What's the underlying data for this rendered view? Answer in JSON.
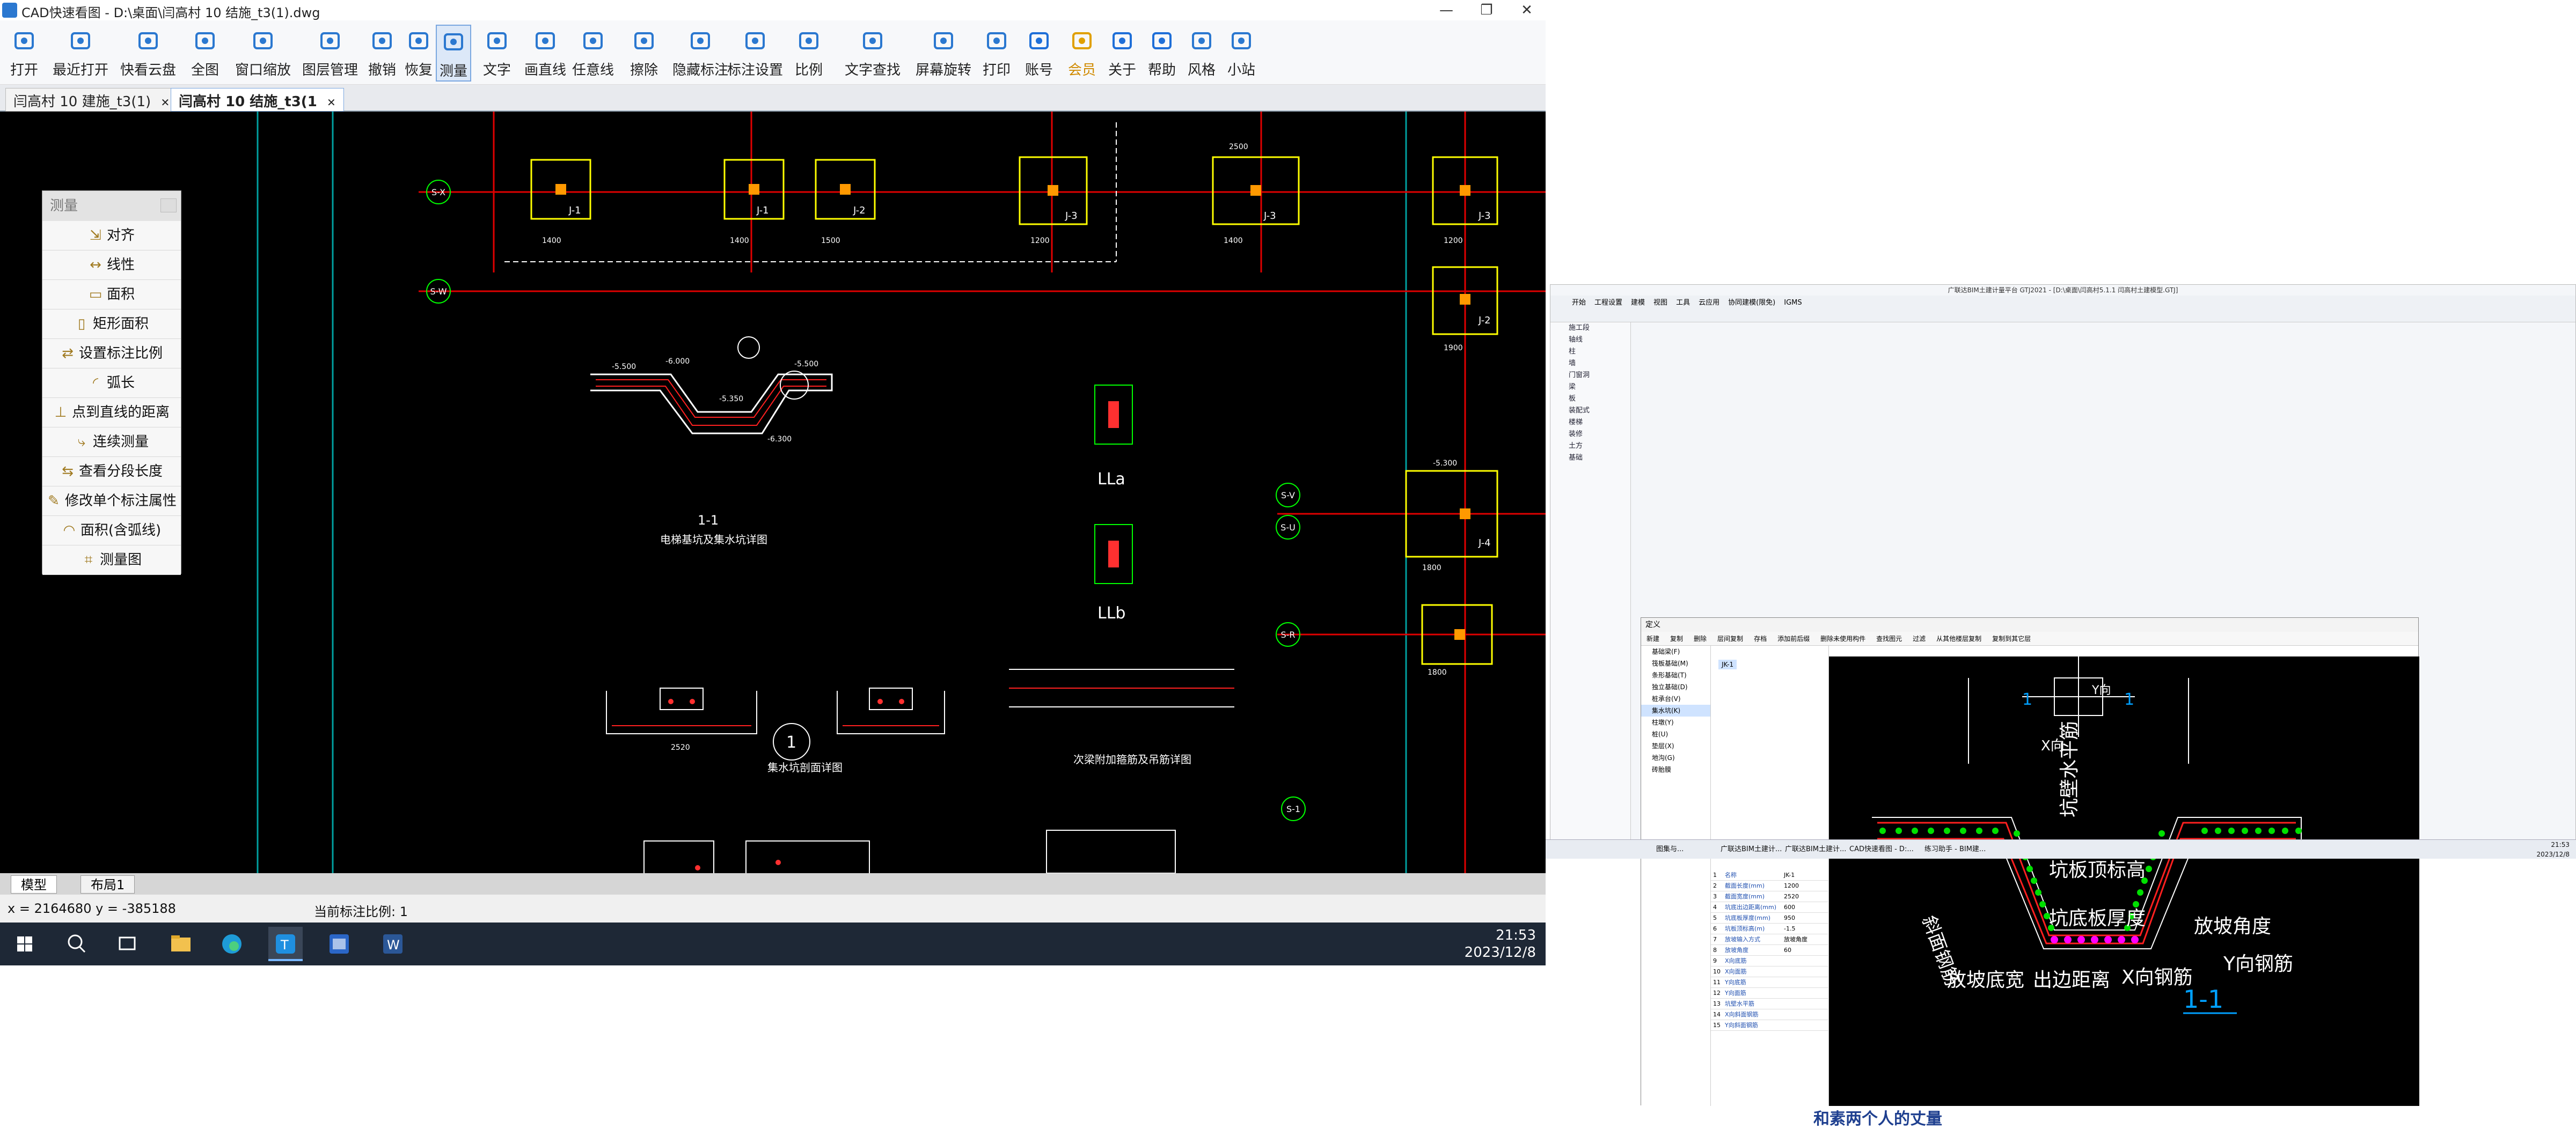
{
  "window": {
    "title": "CAD快速看图 - D:\\桌面\\闫高村 10 结施_t3(1).dwg",
    "controls": [
      "—",
      "❐",
      "✕"
    ]
  },
  "toolbar": [
    {
      "label": "打开",
      "icon": "folder-open-icon"
    },
    {
      "label": "最近打开",
      "icon": "history-icon"
    },
    {
      "label": "快看云盘",
      "icon": "cloud-icon"
    },
    {
      "label": "全图",
      "icon": "fit-all-icon"
    },
    {
      "label": "窗口缩放",
      "icon": "zoom-window-icon"
    },
    {
      "label": "图层管理",
      "icon": "layers-icon"
    },
    {
      "label": "撤销",
      "icon": "undo-icon"
    },
    {
      "label": "恢复",
      "icon": "redo-icon"
    },
    {
      "label": "测量",
      "icon": "measure-icon"
    },
    {
      "label": "文字",
      "icon": "text-icon"
    },
    {
      "label": "画直线",
      "icon": "line-icon"
    },
    {
      "label": "任意线",
      "icon": "freehand-icon"
    },
    {
      "label": "擦除",
      "icon": "eraser-icon"
    },
    {
      "label": "隐藏标注",
      "icon": "hide-annotation-icon"
    },
    {
      "label": "标注设置",
      "icon": "annotation-settings-icon"
    },
    {
      "label": "比例",
      "icon": "scale-icon"
    },
    {
      "label": "文字查找",
      "icon": "text-search-icon"
    },
    {
      "label": "屏幕旋转",
      "icon": "rotate-screen-icon"
    },
    {
      "label": "打印",
      "icon": "print-icon"
    },
    {
      "label": "账号",
      "icon": "account-icon"
    },
    {
      "label": "会员",
      "icon": "vip-icon"
    },
    {
      "label": "关于",
      "icon": "info-icon"
    },
    {
      "label": "帮助",
      "icon": "help-icon"
    },
    {
      "label": "风格",
      "icon": "style-icon"
    },
    {
      "label": "小站",
      "icon": "station-icon"
    }
  ],
  "doc_tabs": [
    {
      "label": "闫高村 10 建施_t3(1)",
      "close": "✕"
    },
    {
      "label": "闫高村 10 结施_t3(1",
      "close": "✕"
    }
  ],
  "measure_panel": {
    "title": "测量",
    "items": [
      {
        "label": "对齐",
        "glyph": "⇲"
      },
      {
        "label": "线性",
        "glyph": "↔"
      },
      {
        "label": "面积",
        "glyph": "▭"
      },
      {
        "label": "矩形面积",
        "glyph": "▯"
      },
      {
        "label": "设置标注比例",
        "glyph": "⇄"
      },
      {
        "label": "弧长",
        "glyph": "◜"
      },
      {
        "label": "点到直线的距离",
        "glyph": "⊥"
      },
      {
        "label": "连续测量",
        "glyph": "⤷"
      },
      {
        "label": "查看分段长度",
        "glyph": "⇆"
      },
      {
        "label": "修改单个标注属性",
        "glyph": "✎"
      },
      {
        "label": "面积(含弧线)",
        "glyph": "◠"
      },
      {
        "label": "测量图",
        "glyph": "⌗"
      }
    ]
  },
  "drawing": {
    "axis_labels": [
      "S-X",
      "S-W",
      "S-V",
      "S-U",
      "S-R",
      "S-1"
    ],
    "footing_labels": [
      "J-1",
      "J-1",
      "J-2",
      "J-3",
      "J-3",
      "J-3",
      "J-3",
      "J-2",
      "J-4",
      "J-4"
    ],
    "section_title": "1-1",
    "section_note": "电梯基坑及集水坑详图",
    "ll_labels": [
      "LLa",
      "LLb"
    ],
    "circle_mark": "1",
    "note_bottom_left": "集水坑剖面详图",
    "note_bottom_right": "次梁附加箍筋及吊筋详图",
    "dims": [
      "1400",
      "1400",
      "1500",
      "1200",
      "1400",
      "2500",
      "1200",
      "1900",
      "1800",
      "1800",
      "2520",
      "-5.500",
      "-6.000",
      "-5.350",
      "-6.300",
      "-5.500",
      "-5.300"
    ]
  },
  "layout_tabs": [
    "模型",
    "布局1"
  ],
  "status": {
    "coords": "x = 2164680  y = -385188",
    "scale": "当前标注比例: 1"
  },
  "taskbar": {
    "apps": [
      "start-icon",
      "search-icon",
      "task-view-icon",
      "file-explorer-icon",
      "edge-icon",
      "cad-viewer-icon",
      "gtj-icon",
      "word-icon"
    ],
    "time": "21:53",
    "date": "2023/12/8"
  },
  "right_screen": {
    "app_title": "广联达BIM土建计量平台 GTJ2021 - [D:\\桌面\\闫高村5.1.1 闫高村土建模型.GTJ]",
    "menu": [
      "开始",
      "工程设置",
      "建模",
      "视图",
      "工具",
      "云应用",
      "协同建模(限免)",
      "IGMS"
    ],
    "nav_items": [
      "施工段",
      "轴线",
      "柱",
      "墙",
      "门窗洞",
      "梁",
      "板",
      "装配式",
      "楼梯",
      "装修",
      "土方",
      "基础"
    ],
    "dialog_title": "定义",
    "dialog_toolbar": [
      "新建",
      "复制",
      "删除",
      "层间复制",
      "存档",
      "添加前后缀",
      "删除未使用构件",
      "查找图元",
      "过滤",
      "从其他楼层复制",
      "复制到其它层"
    ],
    "component_tree": [
      "基础梁(F)",
      "筏板基础(M)",
      "条形基础(T)",
      "独立基础(D)",
      "桩承台(V)",
      "集水坑(K)",
      "柱墩(Y)",
      "桩(U)",
      "垫层(X)",
      "地沟(G)",
      "砖胎膜"
    ],
    "selected_component": "JK-1",
    "property_rows": [
      {
        "n": "1",
        "k": "名称",
        "v": "JK-1"
      },
      {
        "n": "2",
        "k": "截面长度(mm)",
        "v": "1200"
      },
      {
        "n": "3",
        "k": "截面宽度(mm)",
        "v": "2520"
      },
      {
        "n": "4",
        "k": "坑底出边距离(mm)",
        "v": "600"
      },
      {
        "n": "5",
        "k": "坑底板厚度(mm)",
        "v": "950"
      },
      {
        "n": "6",
        "k": "坑板顶标高(m)",
        "v": "-1.5"
      },
      {
        "n": "7",
        "k": "放坡输入方式",
        "v": "放坡角度"
      },
      {
        "n": "8",
        "k": "放坡角度",
        "v": "60"
      },
      {
        "n": "9",
        "k": "X向底筋",
        "v": ""
      },
      {
        "n": "10",
        "k": "X向面筋",
        "v": ""
      },
      {
        "n": "11",
        "k": "Y向底筋",
        "v": ""
      },
      {
        "n": "12",
        "k": "Y向面筋",
        "v": ""
      },
      {
        "n": "13",
        "k": "坑壁水平筋",
        "v": ""
      },
      {
        "n": "14",
        "k": "X向斜面钢筋",
        "v": ""
      },
      {
        "n": "15",
        "k": "Y向斜面钢筋",
        "v": ""
      }
    ],
    "section_labels": {
      "wall_bar": "坑壁水平筋",
      "slab_top": "坑板顶标高",
      "slope_bar": "斜面钢筋",
      "slab_thick": "坑底板厚度",
      "slope_angle": "放坡角度",
      "slope_width": "放坡底宽",
      "edge_dist": "出边距离",
      "x_bar": "X向钢筋",
      "y_bar": "Y向钢筋",
      "x_dir": "X向",
      "y_dir": "Y向",
      "mark": "1",
      "title": "1-1"
    },
    "watermark": "和素两个人的丈量",
    "task_items": [
      "图集与...",
      "广联达BIM土建计...",
      "广联达BIM土建计...",
      "CAD快速看图 - D:...",
      "练习助手 - BIM建..."
    ],
    "time": "21:53",
    "date": "2023/12/8"
  }
}
